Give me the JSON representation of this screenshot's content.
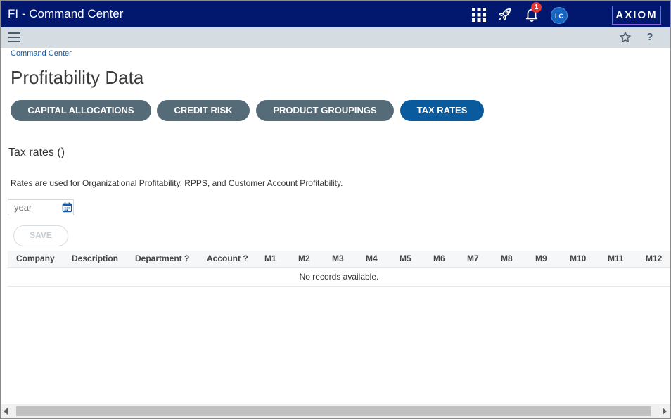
{
  "app": {
    "title": "FI - Command Center",
    "notifications_count": "1",
    "user_initials": "LC",
    "logo_text": "AXIOM",
    "colors": {
      "topbar": "#02186e",
      "subbar": "#d5dce2",
      "tab": "#556b78",
      "tab_active": "#0a5a9e",
      "badge": "#e53935"
    }
  },
  "icons": {
    "apps": "apps-grid-icon",
    "launch": "rocket-icon",
    "notifications": "bell-icon",
    "menu": "hamburger-icon",
    "favorite": "star-icon",
    "help": "help-icon",
    "calendar": "calendar-icon"
  },
  "help_glyph": "?",
  "breadcrumb": "Command Center",
  "page_title": "Profitability Data",
  "tabs": [
    {
      "label": "CAPITAL ALLOCATIONS",
      "active": false
    },
    {
      "label": "CREDIT RISK",
      "active": false
    },
    {
      "label": "PRODUCT GROUPINGS",
      "active": false
    },
    {
      "label": "TAX RATES",
      "active": true
    }
  ],
  "section": {
    "title": "Tax rates ()",
    "description": "Rates are used for Organizational Profitability, RPPS, and Customer Account Profitability."
  },
  "year_input": {
    "value": "",
    "placeholder": "year"
  },
  "save_label": "SAVE",
  "grid": {
    "columns": [
      "Company",
      "Description",
      "Department ?",
      "Account ?",
      "M1",
      "M2",
      "M3",
      "M4",
      "M5",
      "M6",
      "M7",
      "M8",
      "M9",
      "M10",
      "M11",
      "M12"
    ],
    "empty_message": "No records available."
  }
}
